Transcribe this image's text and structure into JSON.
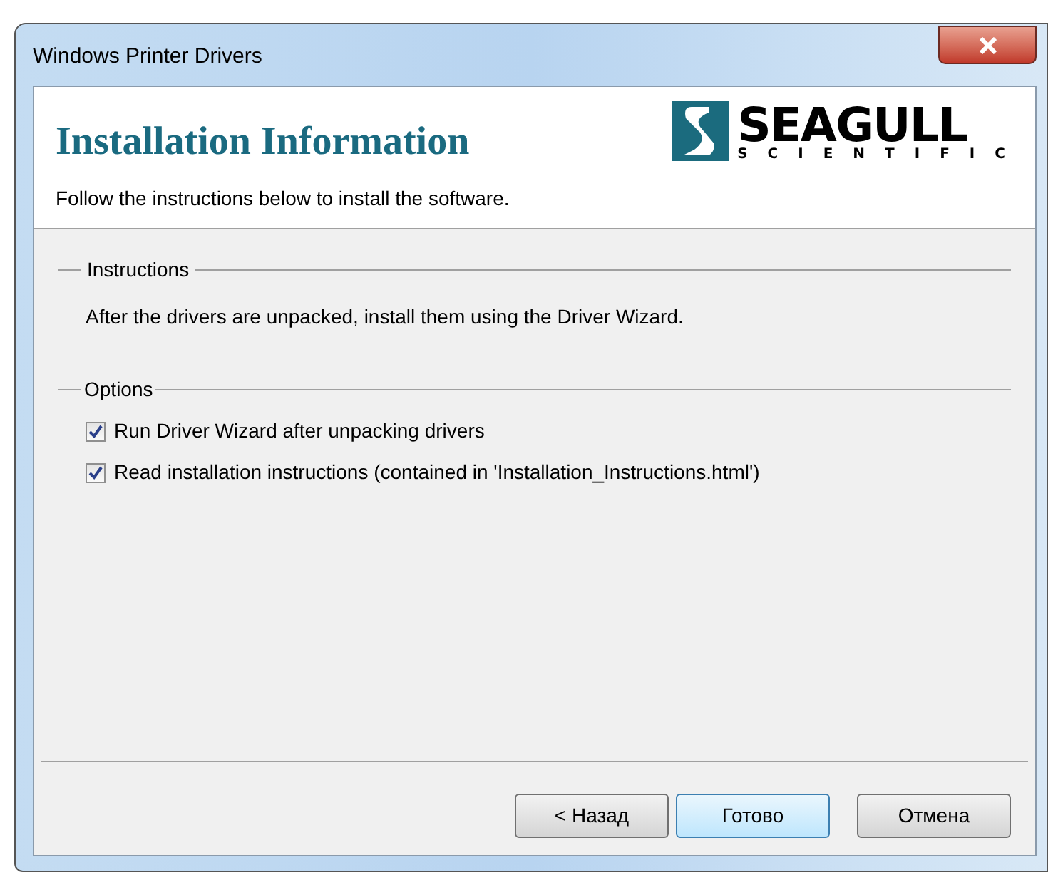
{
  "window": {
    "title": "Windows Printer Drivers"
  },
  "header": {
    "title": "Installation Information",
    "subtitle": "Follow the instructions below to install the software.",
    "logo": {
      "word": "SEAGULL",
      "tagline": "SCIENTIFIC"
    }
  },
  "instructions": {
    "label": "Instructions",
    "text": "After the drivers are unpacked, install them using the Driver Wizard."
  },
  "options": {
    "label": "Options",
    "items": [
      {
        "label": "Run Driver Wizard after unpacking drivers",
        "checked": true
      },
      {
        "label": "Read installation instructions (contained in 'Installation_Instructions.html')",
        "checked": true
      }
    ]
  },
  "buttons": [
    {
      "label": "< Назад",
      "default": false
    },
    {
      "label": "Готово",
      "default": true
    },
    {
      "label": "Отмена",
      "default": false
    }
  ]
}
